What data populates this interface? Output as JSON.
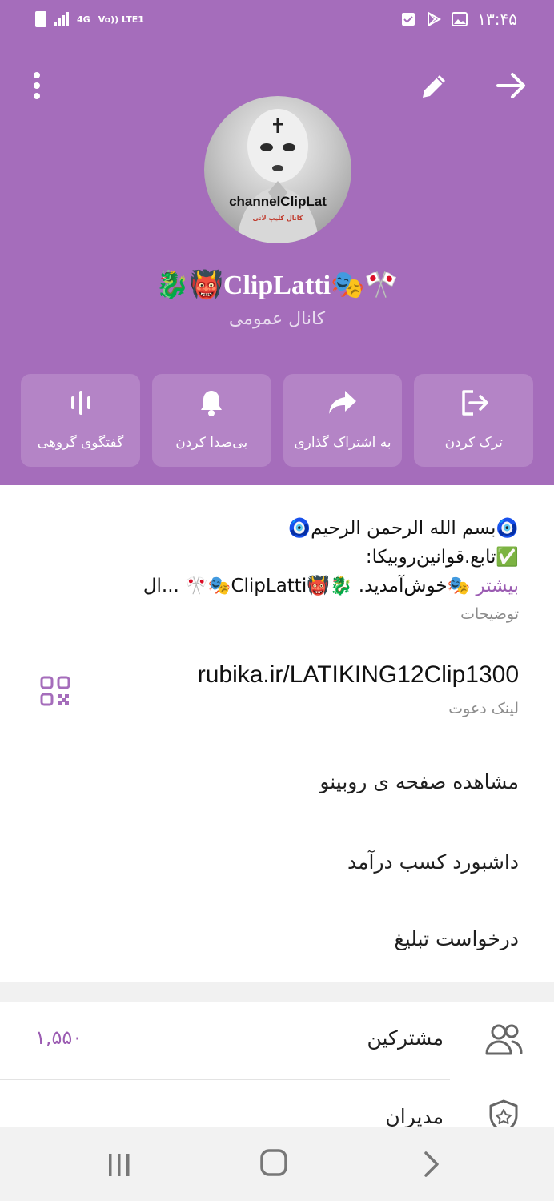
{
  "status_bar": {
    "time": "۱۳:۴۵",
    "network_4g": "4G",
    "network_lte": "Vo)) LTE1"
  },
  "header": {
    "channel_name": "🐉👹ClipLatti🎭🎌",
    "channel_type": "کانال عمومی",
    "avatar_text": "channelClipLat",
    "avatar_subtext": "کانال کلیپ لاتی"
  },
  "actions": [
    {
      "label": "ترک کردن",
      "icon": "leave-icon"
    },
    {
      "label": "به اشتراک گذاری",
      "icon": "share-icon"
    },
    {
      "label": "بی‌صدا کردن",
      "icon": "bell-icon"
    },
    {
      "label": "گفتگوی گروهی",
      "icon": "voice-chat-icon"
    }
  ],
  "description": {
    "line1": "🧿بسم الله الرحمن الرحیم🧿",
    "line2": "✅تابع.قوانین‌روبیکا:",
    "line3": "🎭خوش‌آمدید. 🐉👹ClipLatti🎭🎌 ...ال",
    "more": "بیشتر",
    "caption": "توضیحات"
  },
  "invite_link": {
    "value": "rubika.ir/LATIKING12Clip1300",
    "caption": "لینک دعوت"
  },
  "menu": {
    "rubino": "مشاهده صفحه ی روبینو",
    "dashboard": "داشبورد کسب درآمد",
    "ads": "درخواست تبلیغ"
  },
  "members": {
    "subscribers_label": "مشترکین",
    "subscribers_count": "۱,۵۵۰",
    "admins_label": "مدیران"
  },
  "colors": {
    "primary": "#a56dbb",
    "button": "#b484c6",
    "accent": "#9b5cb2"
  }
}
